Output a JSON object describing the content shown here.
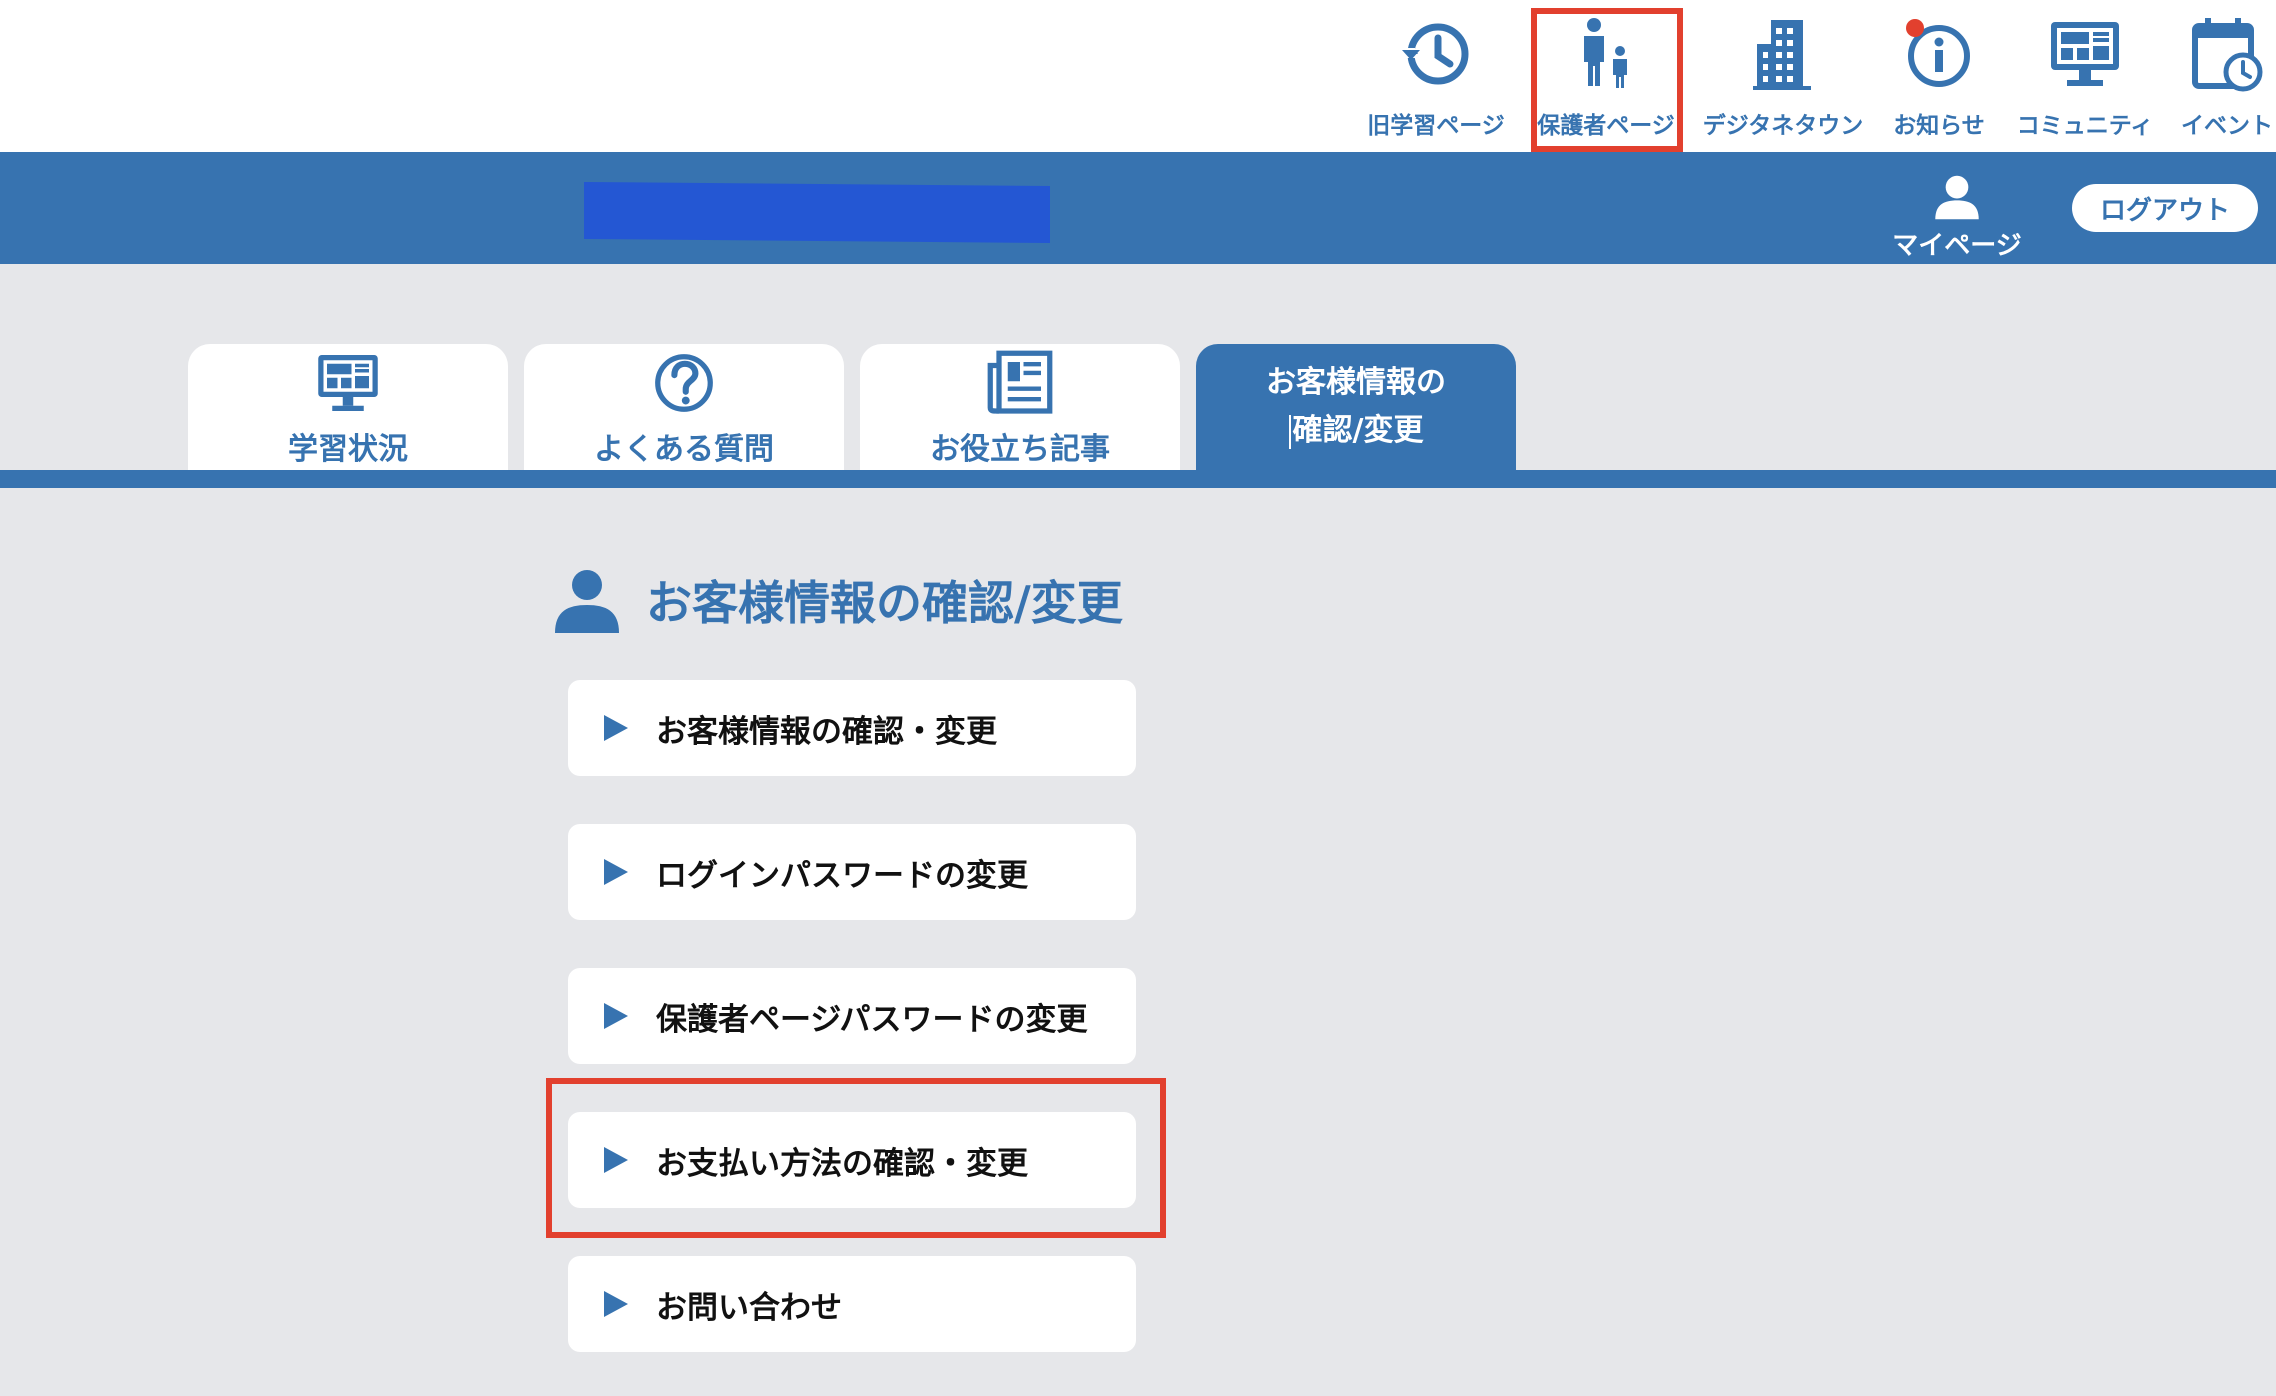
{
  "top_nav": {
    "items": [
      {
        "label": "旧学習ページ",
        "icon": "history-icon"
      },
      {
        "label": "保護者ページ",
        "icon": "parent-child-icon"
      },
      {
        "label": "デジタネタウン",
        "icon": "building-icon"
      },
      {
        "label": "お知らせ",
        "icon": "info-icon"
      },
      {
        "label": "コミュニティ",
        "icon": "monitor-icon"
      },
      {
        "label": "イベント",
        "icon": "calendar-clock-icon"
      }
    ]
  },
  "header": {
    "mypage_label": "マイページ",
    "logout_label": "ログアウト"
  },
  "tabs": [
    {
      "label": "学習状況",
      "icon": "monitor-icon"
    },
    {
      "label": "よくある質問",
      "icon": "question-icon"
    },
    {
      "label": "お役立ち記事",
      "icon": "newspaper-icon"
    },
    {
      "label_line1": "お客様情報の",
      "label_line2": "確認/変更",
      "active": true
    }
  ],
  "section": {
    "title": "お客様情報の確認/変更"
  },
  "menu": [
    {
      "label": "お客様情報の確認・変更"
    },
    {
      "label": "ログインパスワードの変更"
    },
    {
      "label": "保護者ページパスワードの変更"
    },
    {
      "label": "お支払い方法の確認・変更"
    },
    {
      "label": "お問い合わせ"
    }
  ],
  "colors": {
    "primary": "#3773b0",
    "highlight": "#e2402e",
    "background": "#e6e7ea",
    "notification_dot": "#e2402e"
  }
}
